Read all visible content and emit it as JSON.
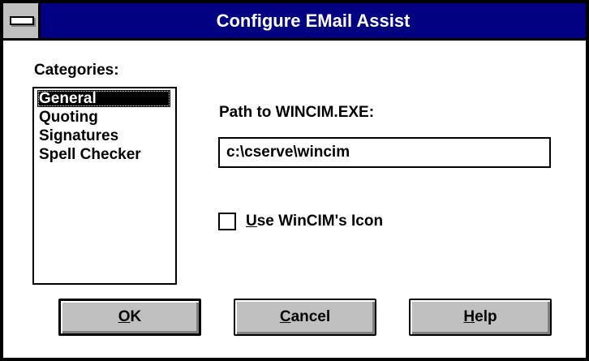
{
  "window": {
    "title": "Configure EMail Assist"
  },
  "categories": {
    "label": "Categories:",
    "items": [
      {
        "label": "General",
        "selected": true
      },
      {
        "label": "Quoting",
        "selected": false
      },
      {
        "label": "Signatures",
        "selected": false
      },
      {
        "label": "Spell Checker",
        "selected": false
      }
    ]
  },
  "general": {
    "path_label": "Path to WINCIM.EXE:",
    "path_value": "c:\\cserve\\wincim",
    "checkbox": {
      "checked": false,
      "mnemonic": "U",
      "label_rest": "se WinCIM's Icon"
    }
  },
  "buttons": {
    "ok": {
      "mnemonic": "O",
      "rest": "K"
    },
    "cancel": {
      "mnemonic": "C",
      "rest": "ancel"
    },
    "help": {
      "mnemonic": "H",
      "rest": "elp"
    }
  },
  "colors": {
    "titlebar": "#000080",
    "button_face": "#c0c0c0",
    "selection": "#000000"
  }
}
